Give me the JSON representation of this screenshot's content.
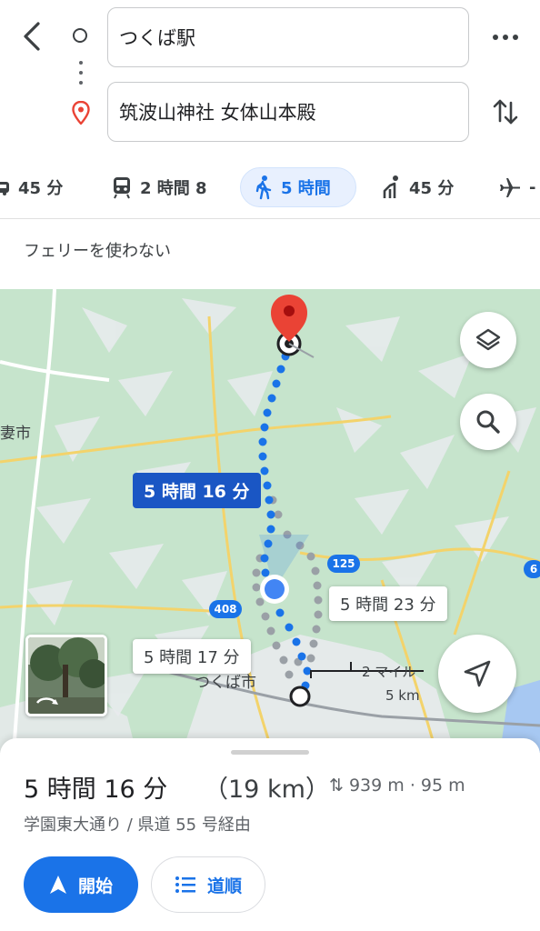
{
  "header": {
    "origin": "つくば駅",
    "destination": "筑波山神社 女体山本殿"
  },
  "modes": [
    {
      "icon": "car-icon",
      "label": "45 分"
    },
    {
      "icon": "train-icon",
      "label": "2 時間 8"
    },
    {
      "icon": "walk-icon",
      "label": "5 時間",
      "selected": true
    },
    {
      "icon": "rideshare-icon",
      "label": "45 分"
    },
    {
      "icon": "flight-icon",
      "label": "-"
    }
  ],
  "options": {
    "ferry": "フェリーを使わない"
  },
  "map": {
    "route_main_label": "5 時間 16 分",
    "route_alt1_label": "5 時間 23 分",
    "route_alt2_label": "5 時間 17 分",
    "place_tsukuba": "つくば市",
    "place_left": "妻市",
    "road_125": "125",
    "road_408": "408",
    "road_6": "6",
    "scale_miles": "2 マイル",
    "scale_km": "5 km"
  },
  "summary": {
    "duration": "5 時間 16 分",
    "distance": "（19 km）",
    "elevation": "939 m · 95 m",
    "via": "学園東大通り / 県道 55 号経由",
    "start_label": "開始",
    "steps_label": "道順"
  },
  "colors": {
    "accent": "#1a73e8",
    "route_label_bg": "#1a56c4",
    "map_green": "#d4ecd9",
    "pin_red": "#ea4335"
  }
}
